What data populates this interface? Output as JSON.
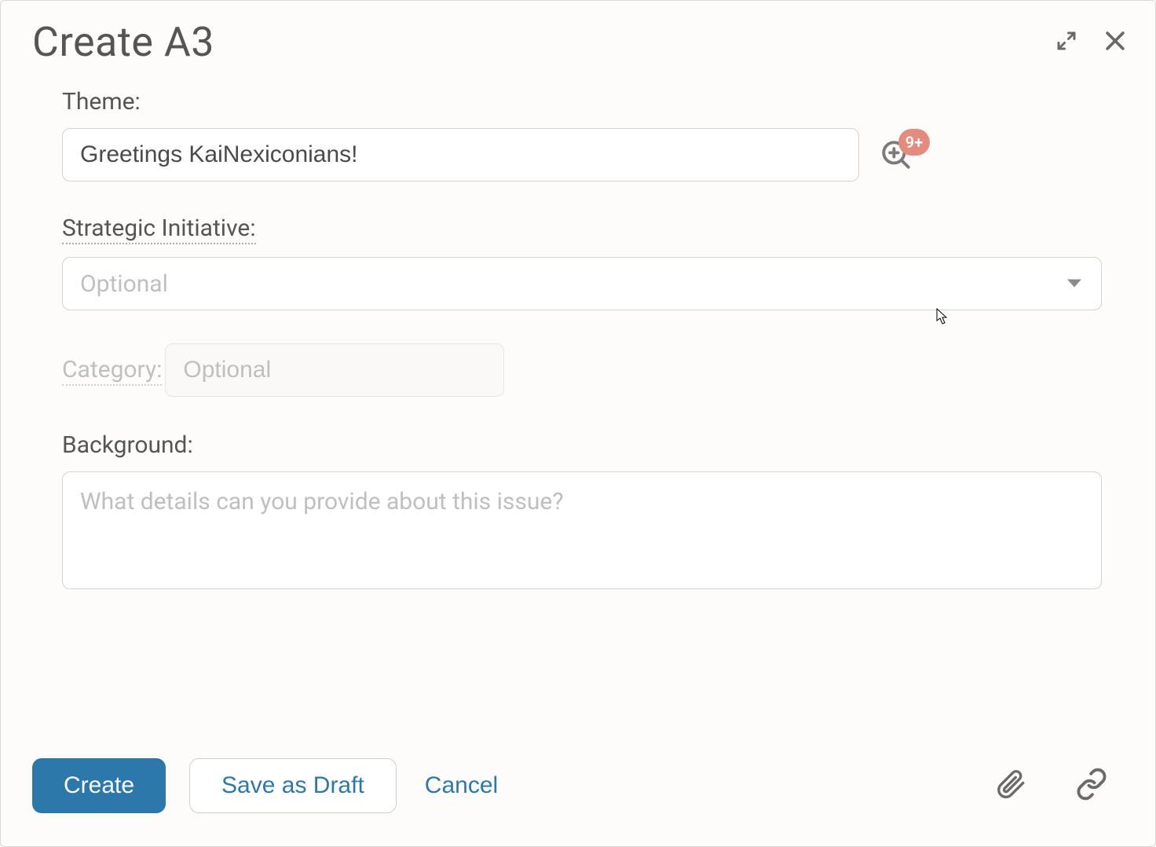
{
  "header": {
    "title": "Create A3"
  },
  "fields": {
    "theme": {
      "label": "Theme:",
      "value": "Greetings KaiNexiconians!",
      "badge": "9+"
    },
    "strategic_initiative": {
      "label": "Strategic Initiative:",
      "placeholder": "Optional"
    },
    "category": {
      "label": "Category:",
      "placeholder": "Optional"
    },
    "background": {
      "label": "Background:",
      "placeholder": "What details can you provide about this issue?"
    }
  },
  "footer": {
    "create": "Create",
    "save_draft": "Save as Draft",
    "cancel": "Cancel"
  }
}
